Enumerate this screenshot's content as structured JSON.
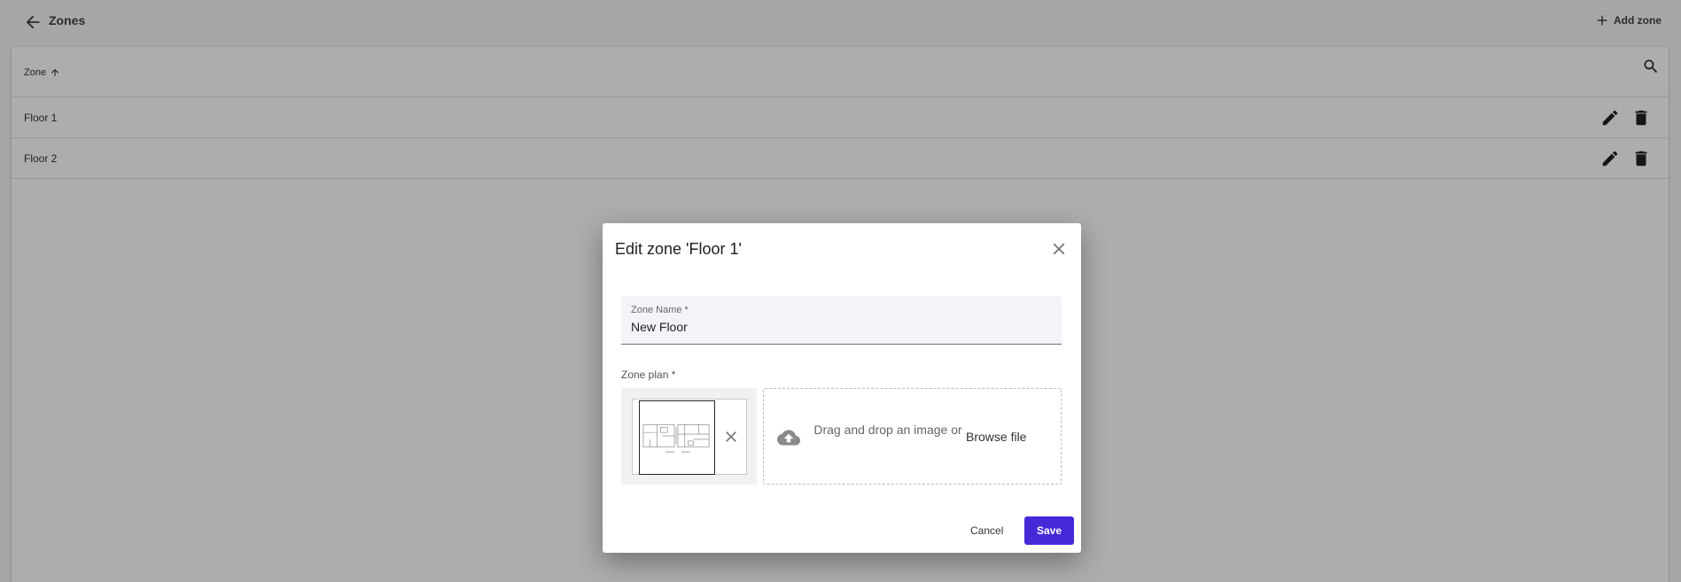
{
  "header": {
    "title": "Zones",
    "add_label": "Add zone"
  },
  "table": {
    "column_header": "Zone",
    "rows": [
      {
        "name": "Floor 1"
      },
      {
        "name": "Floor 2"
      }
    ]
  },
  "dialog": {
    "title": "Edit zone 'Floor 1'",
    "name_field": {
      "label": "Zone Name *",
      "value": "New Floor"
    },
    "plan_label": "Zone plan *",
    "drop_text": "Drag and drop an image or",
    "browse_label": "Browse file",
    "cancel_label": "Cancel",
    "save_label": "Save"
  },
  "colors": {
    "primary": "#4629d6",
    "overlay": "rgba(0,0,0,0.32)"
  },
  "icons": [
    "arrow-back-icon",
    "plus-icon",
    "arrow-up-icon",
    "search-icon",
    "edit-icon",
    "delete-icon",
    "close-icon",
    "cloud-upload-icon"
  ]
}
